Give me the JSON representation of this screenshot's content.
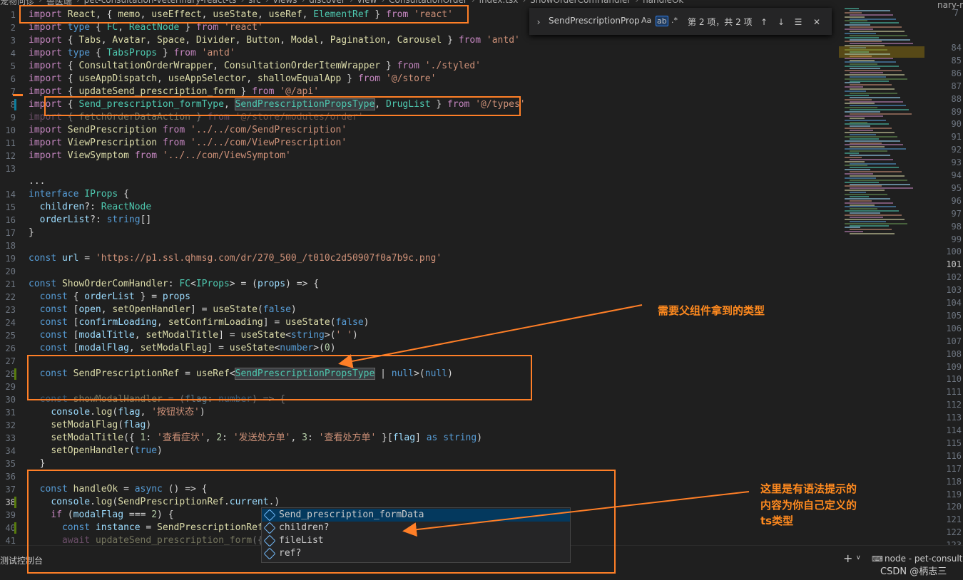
{
  "breadcrumb": [
    "宠物问诊",
    "兽医端",
    "pet-consultation-veterinary-react-ts",
    "src",
    "views",
    "discover",
    "view",
    "ConsultationOrder",
    "index.tsx",
    "ShowOrderComHandler",
    "handleOk"
  ],
  "right_tab_fragment": "nary-re",
  "find_widget": {
    "query": "SendPrescriptionProp",
    "opt_case": "Aa",
    "opt_word": "ab",
    "opt_regex": ".*",
    "result": "第 2 项，共 2 项"
  },
  "code_lines": [
    {
      "n": "1",
      "t": "import React, { memo, useEffect, useState, useRef, ElementRef } from 'react'"
    },
    {
      "n": "2",
      "t": "import type { FC, ReactNode } from 'react'"
    },
    {
      "n": "3",
      "t": "import { Tabs, Avatar, Space, Divider, Button, Modal, Pagination, Carousel } from 'antd'"
    },
    {
      "n": "4",
      "t": "import type { TabsProps } from 'antd'"
    },
    {
      "n": "5",
      "t": "import { ConsultationOrderWrapper, ConsultationOrderItemWrapper } from './styled'"
    },
    {
      "n": "6",
      "t": "import { useAppDispatch, useAppSelector, shallowEqualApp } from '@/store'"
    },
    {
      "n": "7",
      "t": "import { updateSend_prescription_form } from '@/api'"
    },
    {
      "n": "8",
      "t": "import { Send_prescription_formType, SendPrescriptionPropsType, DrugList } from '@/types'"
    },
    {
      "n": "9",
      "t": "import { fetchOrderDataAction } from '@/store/modules/order'"
    },
    {
      "n": "10",
      "t": "import SendPrescription from '../../com/SendPrescription'"
    },
    {
      "n": "11",
      "t": "import ViewPrescription from '../../com/ViewPrescription'"
    },
    {
      "n": "12",
      "t": "import ViewSymptom from '../../com/ViewSymptom'"
    },
    {
      "n": "13",
      "t": ""
    },
    {
      "n": "",
      "t": "..."
    },
    {
      "n": "14",
      "t": "interface IProps {"
    },
    {
      "n": "15",
      "t": "  children?: ReactNode"
    },
    {
      "n": "16",
      "t": "  orderList?: string[]"
    },
    {
      "n": "17",
      "t": "}"
    },
    {
      "n": "18",
      "t": ""
    },
    {
      "n": "19",
      "t": "const url = 'https://p1.ssl.qhmsg.com/dr/270_500_/t010c2d50907f0a7b9c.png'"
    },
    {
      "n": "20",
      "t": ""
    },
    {
      "n": "21",
      "t": "const ShowOrderComHandler: FC<IProps> = (props) => {"
    },
    {
      "n": "22",
      "t": "  const { orderList } = props"
    },
    {
      "n": "23",
      "t": "  const [open, setOpenHandler] = useState(false)"
    },
    {
      "n": "24",
      "t": "  const [confirmLoading, setConfirmLoading] = useState(false)"
    },
    {
      "n": "25",
      "t": "  const [modalTitle, setModalTitle] = useState<string>(' ')"
    },
    {
      "n": "26",
      "t": "  const [modalFlag, setModalFlag] = useState<number>(0)"
    },
    {
      "n": "27",
      "t": ""
    },
    {
      "n": "28",
      "t": "  const SendPrescriptionRef = useRef<SendPrescriptionPropsType | null>(null)"
    },
    {
      "n": "29",
      "t": ""
    },
    {
      "n": "30",
      "t": "  const showModalHandler = (flag: number) => {"
    },
    {
      "n": "31",
      "t": "    console.log(flag, '按钮状态')"
    },
    {
      "n": "32",
      "t": "    setModalFlag(flag)"
    },
    {
      "n": "33",
      "t": "    setModalTitle({ 1: '查看症状', 2: '发送处方单', 3: '查看处方单' }[flag] as string)"
    },
    {
      "n": "34",
      "t": "    setOpenHandler(true)"
    },
    {
      "n": "35",
      "t": "  }"
    },
    {
      "n": "36",
      "t": ""
    },
    {
      "n": "37",
      "t": "  const handleOk = async () => {"
    },
    {
      "n": "38",
      "t": "    console.log(SendPrescriptionRef.current.)"
    },
    {
      "n": "39",
      "t": "    if (modalFlag === 2) {"
    },
    {
      "n": "40",
      "t": "      const instance = SendPrescriptionRef.c"
    },
    {
      "n": "41",
      "t": "      await updateSend_prescription_form({"
    }
  ],
  "right_line_numbers": [
    "84",
    "85",
    "86",
    "87",
    "88",
    "89",
    "90",
    "91",
    "92",
    "93",
    "94",
    "95",
    "96",
    "97",
    "98",
    "99",
    "100",
    "101",
    "102",
    "103",
    "104",
    "105",
    "106",
    "107",
    "108",
    "109",
    "110",
    "111",
    "112",
    "113",
    "114",
    "115",
    "116",
    "117",
    "118",
    "119",
    "120",
    "121",
    "122",
    "123"
  ],
  "right_top_number": "7",
  "suggestions": [
    "Send_prescription_formData",
    "children?",
    "fileList",
    "ref?"
  ],
  "annotations": {
    "parent_type": "需要父组件拿到的类型",
    "hint_line1": "这里是有语法提示的",
    "hint_line2": "内容为你自己定义的",
    "hint_line3": "ts类型"
  },
  "bottom": {
    "left_panel": "测试控制台",
    "plus": "+",
    "terminal": "node - pet-consultatio",
    "watermark": "CSDN @柄志三"
  },
  "colors": {
    "annotation": "#ff7f27",
    "background": "#1f1f1f"
  }
}
